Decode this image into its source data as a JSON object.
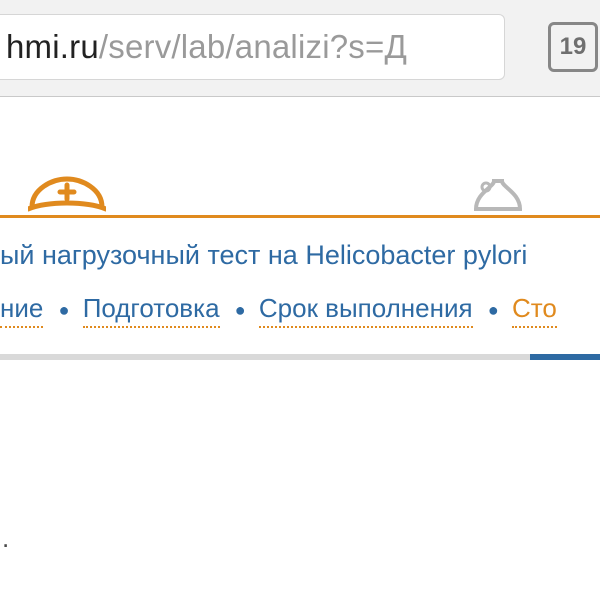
{
  "browser": {
    "url_host": "hmi.ru",
    "url_path": "/serv/lab/analizi?s=Д",
    "tab_count": "19"
  },
  "page": {
    "title_fragment": "ый нагрузочный тест на Helicobacter pylori",
    "tabs": {
      "t1_fragment": "ние",
      "t2": "Подготовка",
      "t3": "Срок выполнения",
      "t4_fragment": "Сто"
    },
    "trailing_char": "."
  }
}
